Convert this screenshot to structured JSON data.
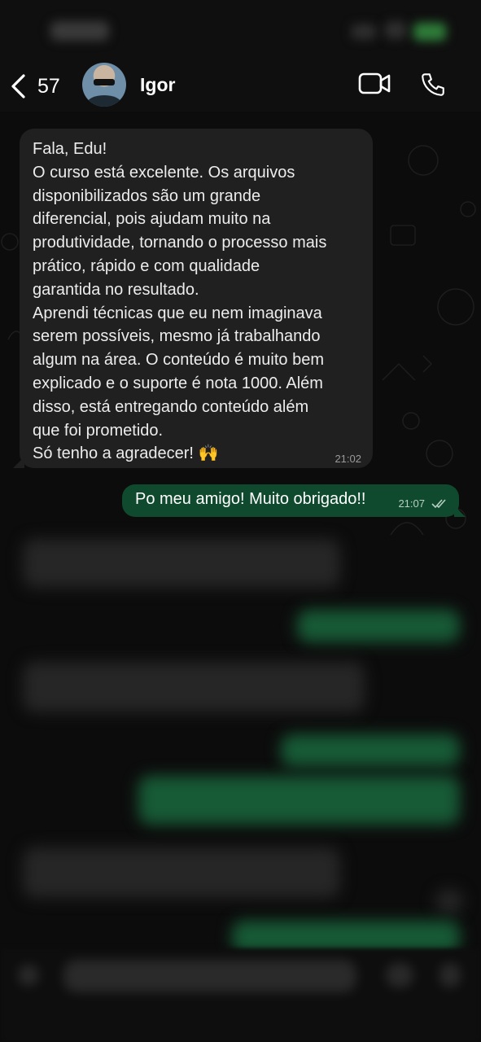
{
  "header": {
    "back_count": "57",
    "contact_name": "Igor"
  },
  "messages": [
    {
      "direction": "incoming",
      "text": "Fala, Edu!\nO curso está excelente. Os arquivos\ndisponibilizados são um grande\ndiferencial, pois ajudam muito na\nprodutividade, tornando o processo mais\nprático, rápido e com qualidade\ngarantida no resultado.\nAprendi técnicas que eu nem imaginava\nserem possíveis, mesmo já trabalhando\nalgum na área. O conteúdo é muito bem\nexplicado e o suporte é nota 1000. Além\ndisso, está entregando conteúdo além\nque foi prometido.\nSó tenho a agradecer! ",
      "emoji": "🙌",
      "time": "21:02"
    },
    {
      "direction": "outgoing",
      "text": "Po meu amigo! Muito obrigado!!",
      "time": "21:07",
      "status": "read"
    }
  ],
  "colors": {
    "background": "#0c0c0c",
    "incoming_bubble": "#202020",
    "outgoing_bubble": "#0f4a2e",
    "read_ticks": "#b6cfc0"
  },
  "icons": [
    "chevron-left-icon",
    "video-call-icon",
    "phone-icon",
    "double-check-icon"
  ]
}
